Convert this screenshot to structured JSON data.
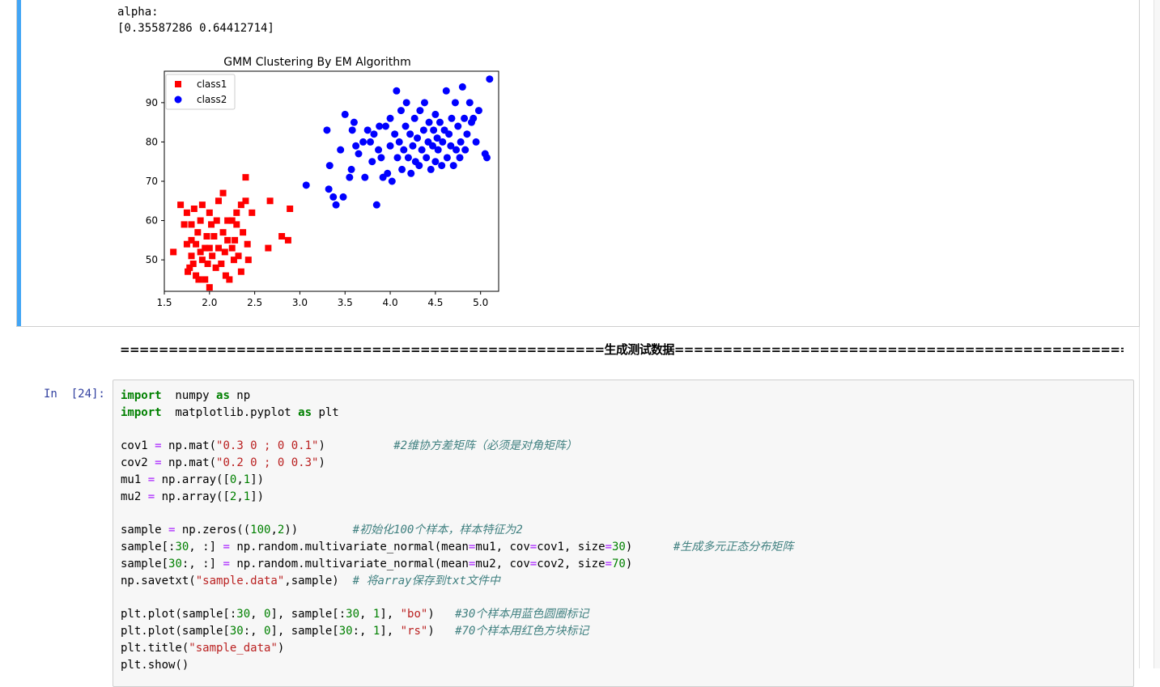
{
  "output": {
    "stdout_lines": [
      "alpha:",
      "[0.35587286 0.64412714]"
    ]
  },
  "chart_data": {
    "type": "scatter",
    "title": "GMM Clustering By EM Algorithm",
    "xlim": [
      1.5,
      5.2
    ],
    "ylim": [
      42,
      98
    ],
    "xticks": [
      "1.5",
      "2.0",
      "2.5",
      "3.0",
      "3.5",
      "4.0",
      "4.5",
      "5.0"
    ],
    "yticks": [
      "50",
      "60",
      "70",
      "80",
      "90"
    ],
    "grid": false,
    "legend_position": "upper left",
    "series": [
      {
        "name": "class1",
        "marker": "square",
        "color": "#ff0000",
        "points": [
          [
            1.6,
            52
          ],
          [
            1.68,
            64
          ],
          [
            1.72,
            59
          ],
          [
            1.75,
            54
          ],
          [
            1.75,
            62
          ],
          [
            1.76,
            47
          ],
          [
            1.78,
            48
          ],
          [
            1.8,
            55
          ],
          [
            1.8,
            51
          ],
          [
            1.8,
            59
          ],
          [
            1.82,
            49
          ],
          [
            1.83,
            63
          ],
          [
            1.85,
            54
          ],
          [
            1.85,
            46
          ],
          [
            1.87,
            57
          ],
          [
            1.88,
            45
          ],
          [
            1.9,
            52
          ],
          [
            1.9,
            60
          ],
          [
            1.92,
            50
          ],
          [
            1.92,
            64
          ],
          [
            1.95,
            53
          ],
          [
            1.95,
            45
          ],
          [
            1.97,
            56
          ],
          [
            1.98,
            49
          ],
          [
            2.0,
            53
          ],
          [
            2.0,
            62
          ],
          [
            2.0,
            43
          ],
          [
            2.02,
            59
          ],
          [
            2.03,
            51
          ],
          [
            2.05,
            56
          ],
          [
            2.07,
            48
          ],
          [
            2.08,
            60
          ],
          [
            2.1,
            53
          ],
          [
            2.1,
            65
          ],
          [
            2.13,
            49
          ],
          [
            2.15,
            57
          ],
          [
            2.15,
            67
          ],
          [
            2.17,
            52
          ],
          [
            2.18,
            46
          ],
          [
            2.2,
            55
          ],
          [
            2.2,
            60
          ],
          [
            2.22,
            45
          ],
          [
            2.25,
            53
          ],
          [
            2.25,
            60
          ],
          [
            2.27,
            50
          ],
          [
            2.28,
            55
          ],
          [
            2.3,
            59
          ],
          [
            2.3,
            62
          ],
          [
            2.32,
            51
          ],
          [
            2.35,
            64
          ],
          [
            2.35,
            47
          ],
          [
            2.37,
            57
          ],
          [
            2.4,
            65
          ],
          [
            2.4,
            71
          ],
          [
            2.42,
            54
          ],
          [
            2.43,
            50
          ],
          [
            2.47,
            62
          ],
          [
            2.65,
            53
          ],
          [
            2.67,
            65
          ],
          [
            2.8,
            56
          ],
          [
            2.87,
            55
          ],
          [
            2.89,
            63
          ]
        ]
      },
      {
        "name": "class2",
        "marker": "circle",
        "color": "#0000ff",
        "points": [
          [
            3.07,
            69
          ],
          [
            3.3,
            83
          ],
          [
            3.32,
            68
          ],
          [
            3.33,
            74
          ],
          [
            3.37,
            66
          ],
          [
            3.4,
            64
          ],
          [
            3.45,
            78
          ],
          [
            3.48,
            66
          ],
          [
            3.5,
            87
          ],
          [
            3.55,
            71
          ],
          [
            3.57,
            73
          ],
          [
            3.58,
            83
          ],
          [
            3.6,
            85
          ],
          [
            3.62,
            79
          ],
          [
            3.65,
            77
          ],
          [
            3.7,
            80
          ],
          [
            3.72,
            71
          ],
          [
            3.75,
            83
          ],
          [
            3.78,
            80
          ],
          [
            3.8,
            75
          ],
          [
            3.82,
            82
          ],
          [
            3.85,
            64
          ],
          [
            3.87,
            78
          ],
          [
            3.88,
            84
          ],
          [
            3.9,
            76
          ],
          [
            3.92,
            71
          ],
          [
            3.95,
            84
          ],
          [
            3.97,
            72
          ],
          [
            4.0,
            79
          ],
          [
            4.0,
            86
          ],
          [
            4.02,
            70
          ],
          [
            4.05,
            82
          ],
          [
            4.07,
            93
          ],
          [
            4.08,
            76
          ],
          [
            4.1,
            80
          ],
          [
            4.12,
            88
          ],
          [
            4.13,
            73
          ],
          [
            4.15,
            78
          ],
          [
            4.17,
            84
          ],
          [
            4.18,
            90
          ],
          [
            4.2,
            76
          ],
          [
            4.22,
            82
          ],
          [
            4.23,
            72
          ],
          [
            4.25,
            79
          ],
          [
            4.27,
            86
          ],
          [
            4.28,
            75
          ],
          [
            4.3,
            81
          ],
          [
            4.32,
            74
          ],
          [
            4.33,
            88
          ],
          [
            4.35,
            78
          ],
          [
            4.37,
            83
          ],
          [
            4.38,
            90
          ],
          [
            4.4,
            76
          ],
          [
            4.42,
            80
          ],
          [
            4.43,
            85
          ],
          [
            4.45,
            73
          ],
          [
            4.47,
            79
          ],
          [
            4.48,
            83
          ],
          [
            4.5,
            87
          ],
          [
            4.5,
            75
          ],
          [
            4.52,
            81
          ],
          [
            4.53,
            78
          ],
          [
            4.55,
            85
          ],
          [
            4.57,
            74
          ],
          [
            4.58,
            80
          ],
          [
            4.6,
            83
          ],
          [
            4.62,
            93
          ],
          [
            4.63,
            76
          ],
          [
            4.65,
            82
          ],
          [
            4.67,
            79
          ],
          [
            4.68,
            86
          ],
          [
            4.7,
            74
          ],
          [
            4.72,
            90
          ],
          [
            4.73,
            78
          ],
          [
            4.75,
            84
          ],
          [
            4.77,
            76
          ],
          [
            4.78,
            80
          ],
          [
            4.8,
            94
          ],
          [
            4.82,
            86
          ],
          [
            4.83,
            78
          ],
          [
            4.85,
            82
          ],
          [
            4.88,
            90
          ],
          [
            4.9,
            85
          ],
          [
            4.92,
            86
          ],
          [
            4.95,
            80
          ],
          [
            4.98,
            88
          ],
          [
            5.05,
            77
          ],
          [
            5.07,
            76
          ],
          [
            5.1,
            96
          ]
        ]
      }
    ]
  },
  "separator": {
    "text": "==================================================生成测试数据=========================================================="
  },
  "cell": {
    "prompt": "In  [24]:",
    "lines": [
      [
        [
          "kw",
          "import"
        ],
        [
          "",
          "  numpy "
        ],
        [
          "kw",
          "as"
        ],
        [
          "",
          " np"
        ]
      ],
      [
        [
          "kw",
          "import"
        ],
        [
          "",
          "  matplotlib.pyplot "
        ],
        [
          "kw",
          "as"
        ],
        [
          "",
          " plt"
        ]
      ],
      [],
      [
        [
          "",
          "cov1 "
        ],
        [
          "op",
          "="
        ],
        [
          "",
          " np.mat("
        ],
        [
          "str",
          "\"0.3 0 ; 0 0.1\""
        ],
        [
          "",
          ")          "
        ],
        [
          "cm",
          "#2维协方差矩阵（必须是对角矩阵）"
        ]
      ],
      [
        [
          "",
          "cov2 "
        ],
        [
          "op",
          "="
        ],
        [
          "",
          " np.mat("
        ],
        [
          "str",
          "\"0.2 0 ; 0 0.3\""
        ],
        [
          "",
          ")"
        ]
      ],
      [
        [
          "",
          "mu1 "
        ],
        [
          "op",
          "="
        ],
        [
          "",
          " np.array(["
        ],
        [
          "num",
          "0"
        ],
        [
          "",
          ","
        ],
        [
          "num",
          "1"
        ],
        [
          "",
          "])"
        ]
      ],
      [
        [
          "",
          "mu2 "
        ],
        [
          "op",
          "="
        ],
        [
          "",
          " np.array(["
        ],
        [
          "num",
          "2"
        ],
        [
          "",
          ","
        ],
        [
          "num",
          "1"
        ],
        [
          "",
          "])"
        ]
      ],
      [],
      [
        [
          "",
          "sample "
        ],
        [
          "op",
          "="
        ],
        [
          "",
          " np.zeros(("
        ],
        [
          "num",
          "100"
        ],
        [
          "",
          ","
        ],
        [
          "num",
          "2"
        ],
        [
          "",
          "))        "
        ],
        [
          "cm",
          "#初始化100个样本，样本特征为2"
        ]
      ],
      [
        [
          "",
          "sample[:"
        ],
        [
          "num",
          "30"
        ],
        [
          "",
          ", :] "
        ],
        [
          "op",
          "="
        ],
        [
          "",
          " np.random.multivariate_normal(mean"
        ],
        [
          "op",
          "="
        ],
        [
          "",
          "mu1, cov"
        ],
        [
          "op",
          "="
        ],
        [
          "",
          "cov1, size"
        ],
        [
          "op",
          "="
        ],
        [
          "num",
          "30"
        ],
        [
          "",
          ")      "
        ],
        [
          "cm",
          "#生成多元正态分布矩阵"
        ]
      ],
      [
        [
          "",
          "sample["
        ],
        [
          "num",
          "30"
        ],
        [
          "",
          ":, :] "
        ],
        [
          "op",
          "="
        ],
        [
          "",
          " np.random.multivariate_normal(mean"
        ],
        [
          "op",
          "="
        ],
        [
          "",
          "mu2, cov"
        ],
        [
          "op",
          "="
        ],
        [
          "",
          "cov2, size"
        ],
        [
          "op",
          "="
        ],
        [
          "num",
          "70"
        ],
        [
          "",
          ")"
        ]
      ],
      [
        [
          "",
          "np.savetxt("
        ],
        [
          "str",
          "\"sample.data\""
        ],
        [
          "",
          ",sample)  "
        ],
        [
          "cm",
          "# 将array保存到txt文件中"
        ]
      ],
      [],
      [
        [
          "",
          "plt.plot(sample[:"
        ],
        [
          "num",
          "30"
        ],
        [
          "",
          ", "
        ],
        [
          "num",
          "0"
        ],
        [
          "",
          "], sample[:"
        ],
        [
          "num",
          "30"
        ],
        [
          "",
          ", "
        ],
        [
          "num",
          "1"
        ],
        [
          "",
          "], "
        ],
        [
          "str",
          "\"bo\""
        ],
        [
          "",
          ")   "
        ],
        [
          "cm",
          "#30个样本用蓝色圆圈标记"
        ]
      ],
      [
        [
          "",
          "plt.plot(sample["
        ],
        [
          "num",
          "30"
        ],
        [
          "",
          ":, "
        ],
        [
          "num",
          "0"
        ],
        [
          "",
          "], sample["
        ],
        [
          "num",
          "30"
        ],
        [
          "",
          ":, "
        ],
        [
          "num",
          "1"
        ],
        [
          "",
          "], "
        ],
        [
          "str",
          "\"rs\""
        ],
        [
          "",
          ")   "
        ],
        [
          "cm",
          "#70个样本用红色方块标记"
        ]
      ],
      [
        [
          "",
          "plt.title("
        ],
        [
          "str",
          "\"sample_data\""
        ],
        [
          "",
          ")"
        ]
      ],
      [
        [
          "",
          "plt.show()"
        ]
      ]
    ]
  }
}
